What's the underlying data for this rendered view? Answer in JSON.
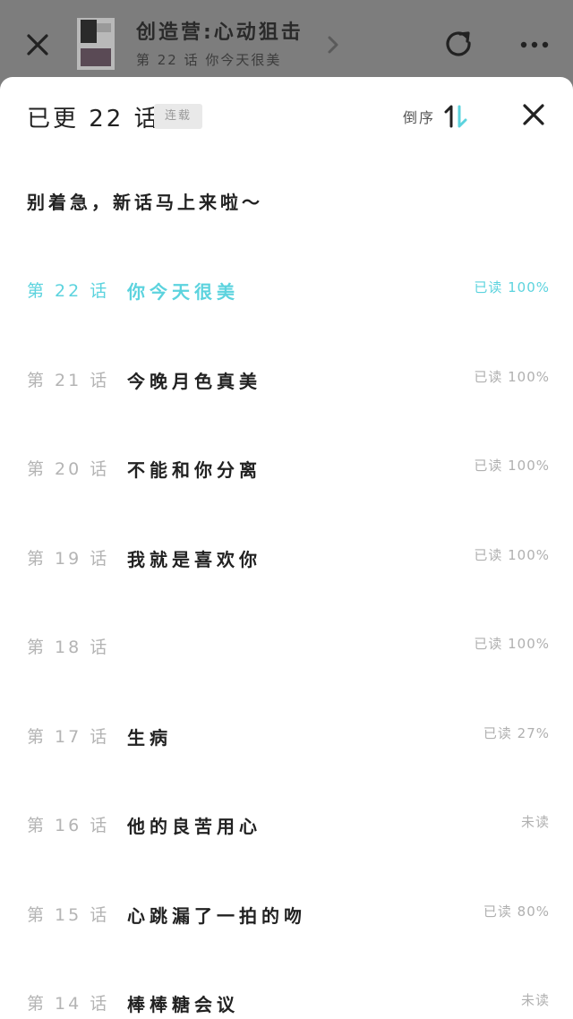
{
  "topbar": {
    "title": "创造营:心动狙击",
    "subtitle": "第 22 话  你今天很美"
  },
  "sheet": {
    "count_label": "已更 22 话",
    "badge": "连载",
    "sort_label": "倒序",
    "notice": "别着急，新话马上来啦～"
  },
  "colors": {
    "accent": "#5cd3de",
    "text_primary": "#222222",
    "text_muted": "#b4b4b4",
    "overlay": "#7b7b7b"
  },
  "episodes": [
    {
      "num": "第 22 话",
      "title": "你今天很美",
      "status": "已读 100%",
      "current": true
    },
    {
      "num": "第 21 话",
      "title": "今晚月色真美",
      "status": "已读 100%"
    },
    {
      "num": "第 20 话",
      "title": "不能和你分离",
      "status": "已读 100%"
    },
    {
      "num": "第 19 话",
      "title": "我就是喜欢你",
      "status": "已读 100%"
    },
    {
      "num": "第 18 话",
      "title": "",
      "status": "已读 100%"
    },
    {
      "num": "第 17 话",
      "title": "生病",
      "status": "已读 27%"
    },
    {
      "num": "第 16 话",
      "title": "他的良苦用心",
      "status": "未读"
    },
    {
      "num": "第 15 话",
      "title": "心跳漏了一拍的吻",
      "status": "已读 80%"
    },
    {
      "num": "第 14 话",
      "title": "棒棒糖会议",
      "status": "未读"
    }
  ]
}
